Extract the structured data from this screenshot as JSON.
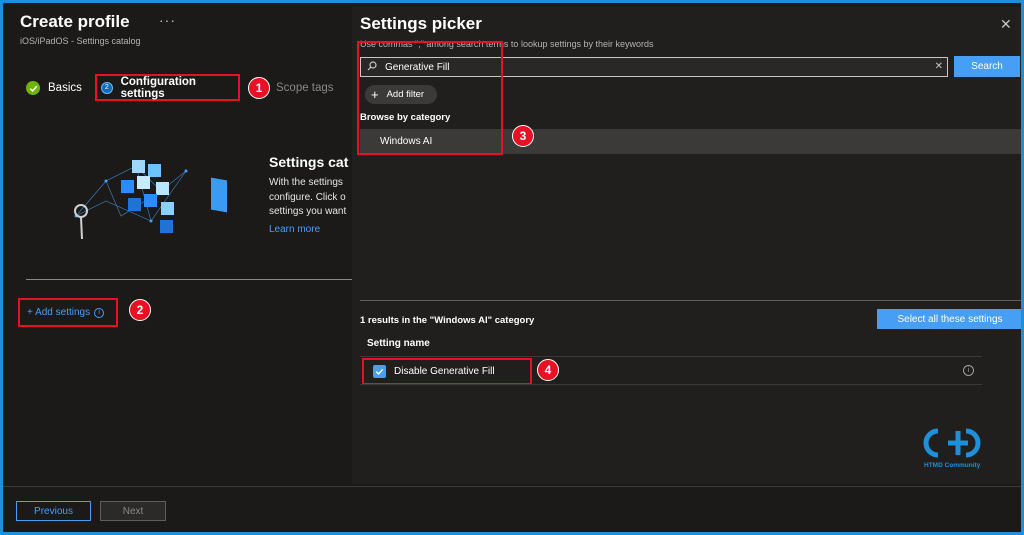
{
  "left": {
    "title": "Create profile",
    "more": "···",
    "subtitle": "iOS/iPadOS - Settings catalog",
    "steps": [
      {
        "label": "Basics"
      },
      {
        "label": "Configuration settings",
        "number": "2"
      },
      {
        "label": "Scope tags"
      }
    ],
    "catalog": {
      "title": "Settings cat",
      "desc_lines": [
        "With the settings",
        "configure. Click o",
        "settings you want"
      ],
      "learn_more": "Learn more"
    },
    "add_settings": "+ Add settings",
    "info_glyph": "i"
  },
  "footer": {
    "previous": "Previous",
    "next": "Next"
  },
  "picker": {
    "title": "Settings picker",
    "close": "✕",
    "hint": "Use commas \",\" among search terms to lookup settings by their keywords",
    "search_value": "Generative Fill",
    "search_button": "Search",
    "add_filter": "Add filter",
    "browse_label": "Browse by category",
    "category": "Windows AI",
    "results_text": "1 results in the \"Windows AI\" category",
    "select_all": "Select all these settings",
    "column_header": "Setting name",
    "setting_name": "Disable Generative Fill"
  },
  "badges": [
    "1",
    "2",
    "3",
    "4"
  ],
  "watermark": "HTMD Community",
  "icons": [
    "check-icon",
    "search-icon",
    "clear-icon",
    "close-icon",
    "plus-icon",
    "info-icon",
    "checkbox-checked-icon"
  ],
  "colors": {
    "accent": "#479ef5",
    "highlight": "#e81123",
    "success": "#6bb700",
    "frame": "#1e8fd8"
  }
}
